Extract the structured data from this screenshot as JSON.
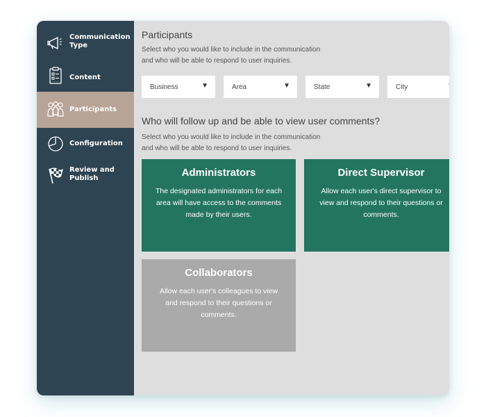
{
  "sidebar": {
    "items": [
      {
        "label": "Communication Type",
        "icon": "megaphone-icon",
        "active": false
      },
      {
        "label": "Content",
        "icon": "clipboard-icon",
        "active": false
      },
      {
        "label": "Participants",
        "icon": "people-icon",
        "active": true
      },
      {
        "label": "Configuration",
        "icon": "pie-chart-icon",
        "active": false
      },
      {
        "label": "Review and Publish",
        "icon": "checkered-flag-icon",
        "active": false
      }
    ]
  },
  "main": {
    "title": "Participants",
    "description_line1": "Select who you would like to include in the communication",
    "description_line2": "and who will be able to respond to user inquiries.",
    "filters": [
      {
        "label": "Business"
      },
      {
        "label": "Area"
      },
      {
        "label": "State"
      },
      {
        "label": "City"
      }
    ],
    "followup_heading": "Who will follow up and be able to view user comments?",
    "followup_desc_line1": "Select who you would like to include in the communication",
    "followup_desc_line2": "and who will be able to respond to user inquiries.",
    "cards": [
      {
        "title": "Administrators",
        "text": "The designated administrators for each area will have access to the comments made by their users.",
        "color": "#247560"
      },
      {
        "title": "Direct Supervisor",
        "text": "Allow each user's direct supervisor to view and respond to their questions or comments.",
        "color": "#247560"
      },
      {
        "title": "Collaborators",
        "text": "Allow each user's colleagues to view and respond to their questions or comments.",
        "color": "#aaaaaa"
      }
    ]
  },
  "colors": {
    "sidebar_bg": "#2f4452",
    "active_item_bg": "#b8a497",
    "main_bg": "#dedede",
    "card_green": "#247560",
    "card_gray": "#aaaaaa"
  }
}
